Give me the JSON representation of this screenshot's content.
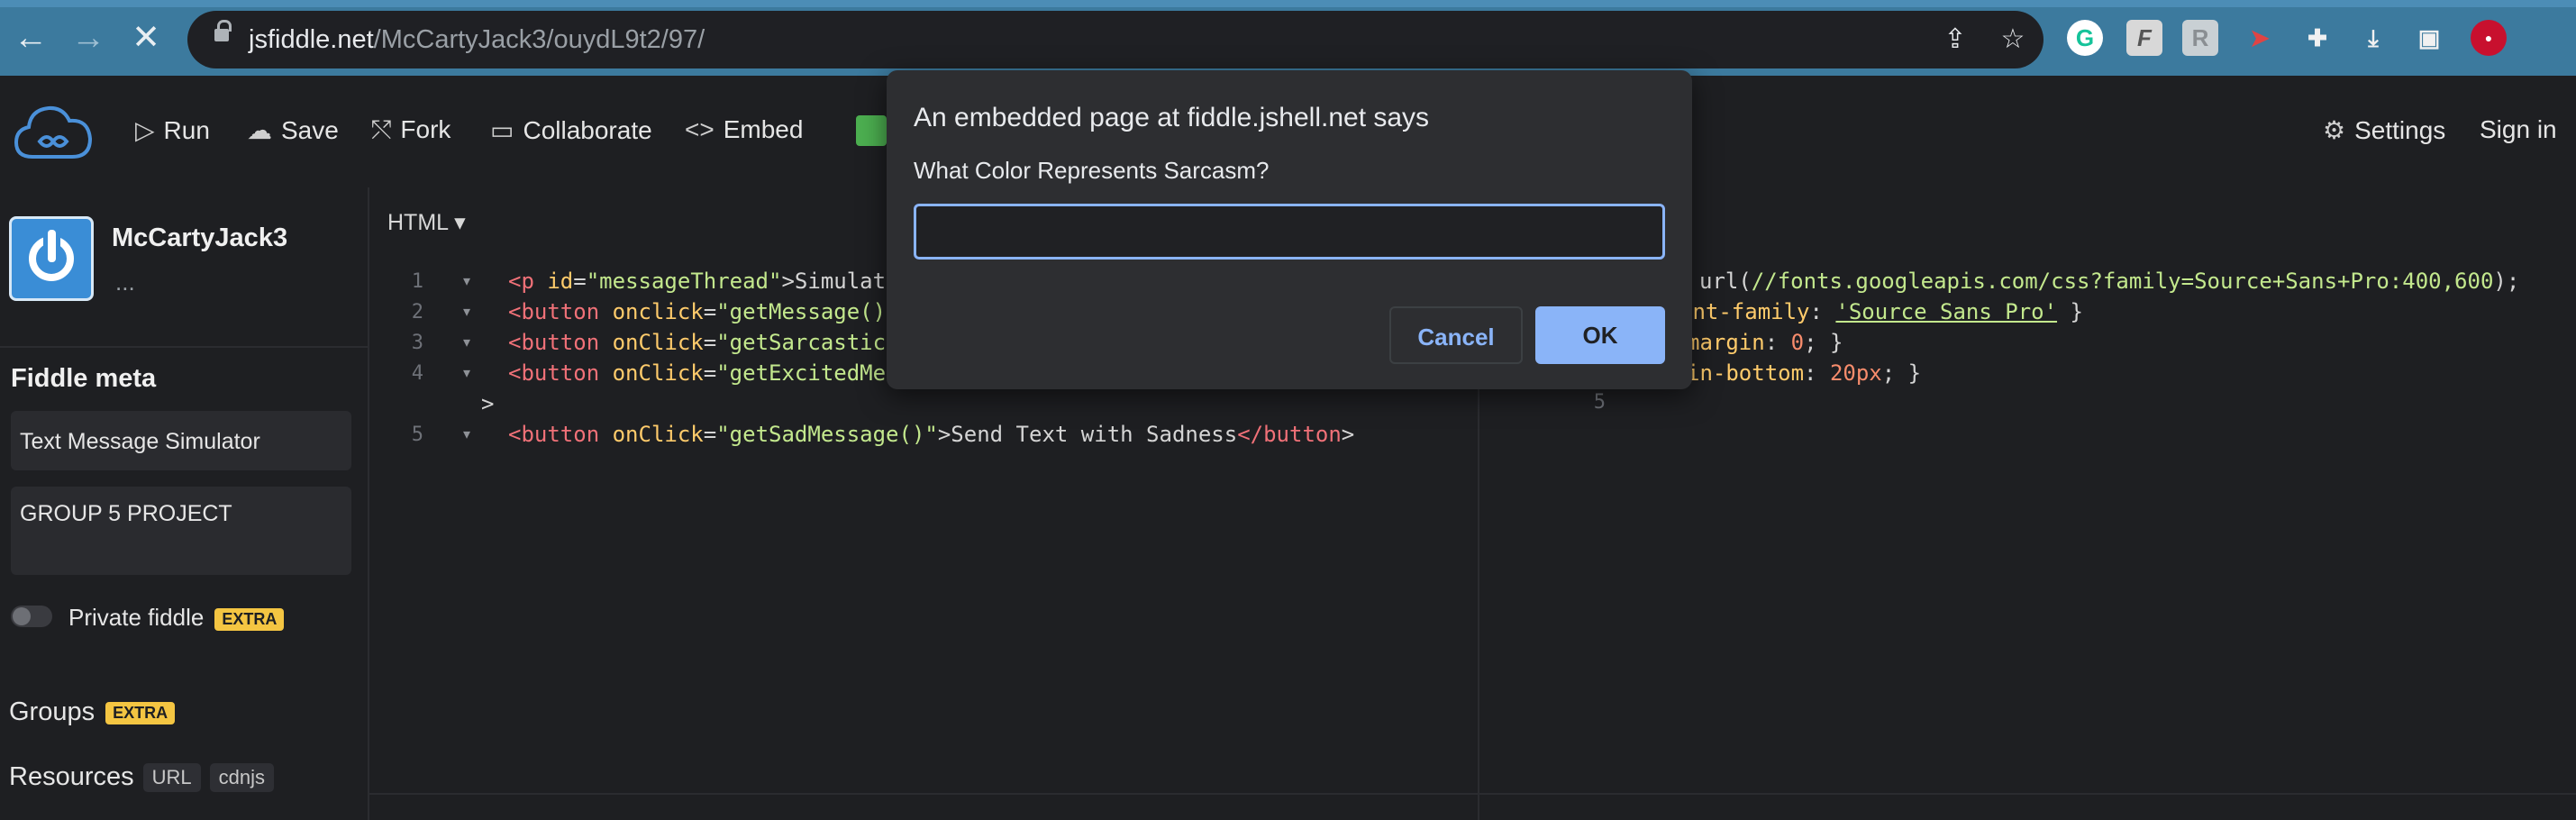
{
  "browser": {
    "url_host": "jsfiddle.net",
    "url_path": "/McCartyJack3/ouydL9t2/97/",
    "icons": [
      "back-icon",
      "forward-icon",
      "stop-icon",
      "share-icon",
      "star-icon",
      "grammarly-icon",
      "extension-f-icon",
      "extension-r-icon",
      "extension-arrow-icon",
      "puzzle-icon",
      "download-icon",
      "sidepanel-icon",
      "profile-icon"
    ]
  },
  "header": {
    "run": "Run",
    "save": "Save",
    "fork": "Fork",
    "collaborate": "Collaborate",
    "embed": "Embed",
    "settings": "Settings",
    "signin": "Sign in"
  },
  "sidebar": {
    "username": "McCartyJack3",
    "ellipsis": "...",
    "meta_title": "Fiddle meta",
    "fiddle_title": "Text Message Simulator",
    "fiddle_description": "GROUP 5 PROJECT",
    "private_label": "Private fiddle",
    "extra_badge": "EXTRA",
    "groups_label": "Groups",
    "resources_label": "Resources",
    "resources_chips": [
      "URL",
      "cdnjs"
    ]
  },
  "html_panel": {
    "tab_label": "HTML",
    "line_numbers": [
      "1",
      "2",
      "3",
      "4",
      "5"
    ]
  },
  "css_panel": {
    "line5_number": "5"
  },
  "dialog": {
    "title": "An embedded page at fiddle.jshell.net says",
    "message": "What Color Represents Sarcasm?",
    "input_value": "",
    "cancel_label": "Cancel",
    "ok_label": "OK"
  },
  "colors": {
    "browser_bar": "#3c7a9e",
    "editor_bg": "#1e1f22",
    "dialog_bg": "#2d2e31",
    "accent_blue": "#8ab4f8",
    "extra_badge": "#f4c542"
  }
}
